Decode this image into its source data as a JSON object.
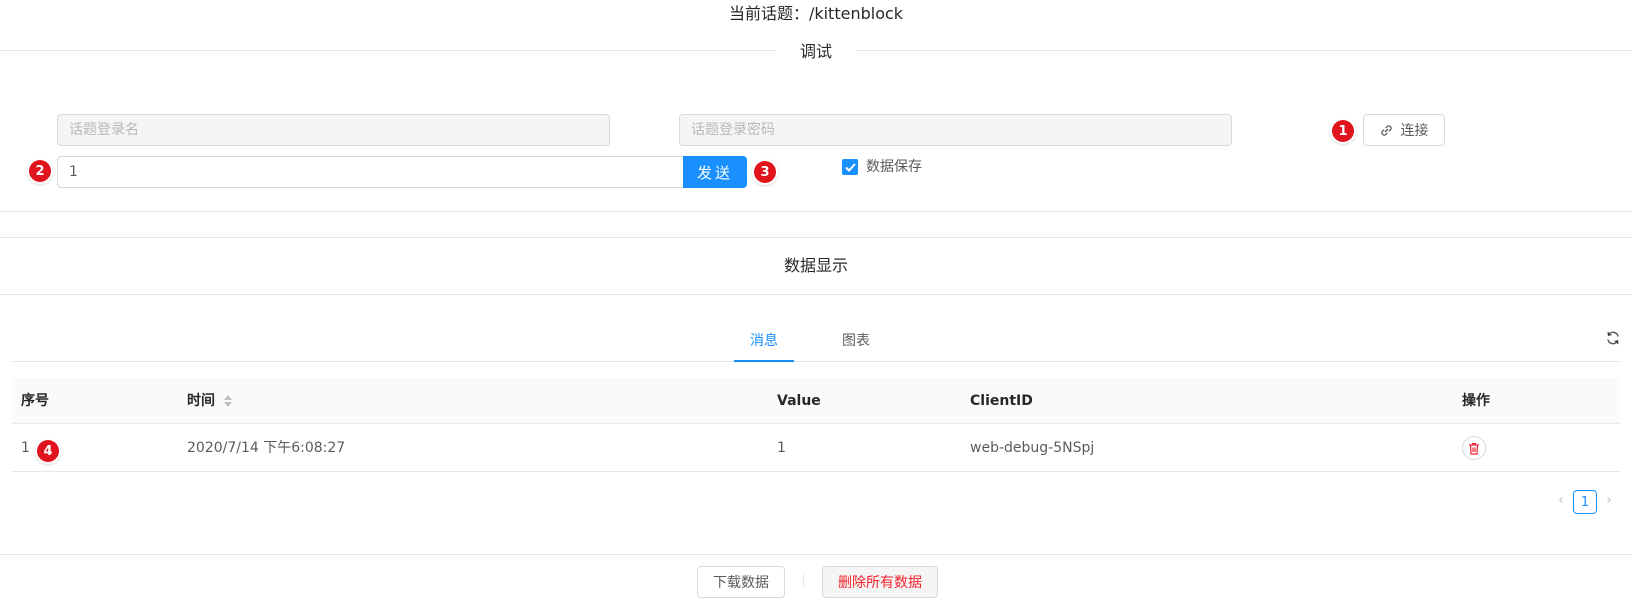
{
  "header": {
    "topic_title": "当前话题：/kittenblock"
  },
  "debug": {
    "divider_label": "调试",
    "username_placeholder": "话题登录名",
    "password_placeholder": "话题登录密码",
    "connect_label": "连接",
    "send_value": "1",
    "send_label": "发送",
    "save_checked": true,
    "save_label": "数据保存"
  },
  "badges": [
    "1",
    "2",
    "3",
    "4"
  ],
  "data_display": {
    "title": "数据显示",
    "tabs": [
      {
        "label": "消息",
        "active": true
      },
      {
        "label": "图表",
        "active": false
      }
    ],
    "refresh_icon": "sync-icon"
  },
  "table": {
    "columns": [
      "序号",
      "时间",
      "Value",
      "ClientID",
      "操作"
    ],
    "rows": [
      {
        "index": "1",
        "time": "2020/7/14 下午6:08:27",
        "value": "1",
        "client_id": "web-debug-5NSpj"
      }
    ],
    "current_page": "1"
  },
  "footer": {
    "download_label": "下载数据",
    "delete_all_label": "删除所有数据"
  },
  "colors": {
    "primary": "#1890ff",
    "danger": "#f5222d",
    "badge": "#e1131c"
  }
}
